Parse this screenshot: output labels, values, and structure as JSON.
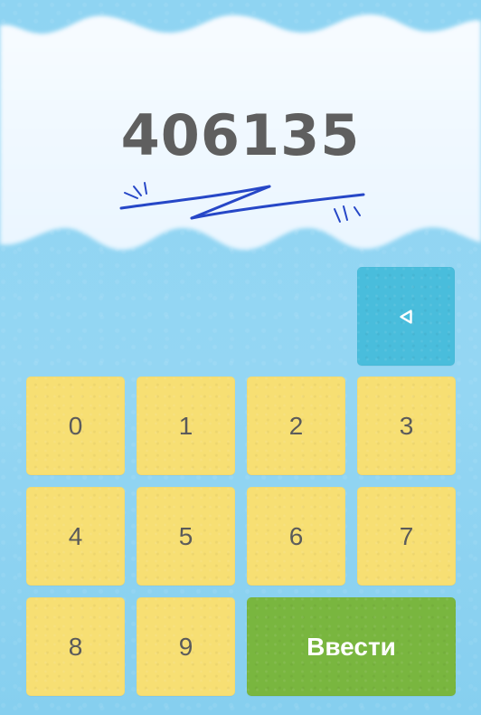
{
  "display": {
    "code": "406135"
  },
  "keypad": {
    "keys": [
      "0",
      "1",
      "2",
      "3",
      "4",
      "5",
      "6",
      "7",
      "8",
      "9"
    ],
    "enter_label": "Ввести",
    "backspace_icon": "backspace-triangle-icon"
  },
  "colors": {
    "background": "#8fd3f1",
    "digit_key": "#f7df73",
    "enter_key": "#79b63f",
    "backspace_key": "#49bddc",
    "code_text": "#5f5f5f"
  }
}
